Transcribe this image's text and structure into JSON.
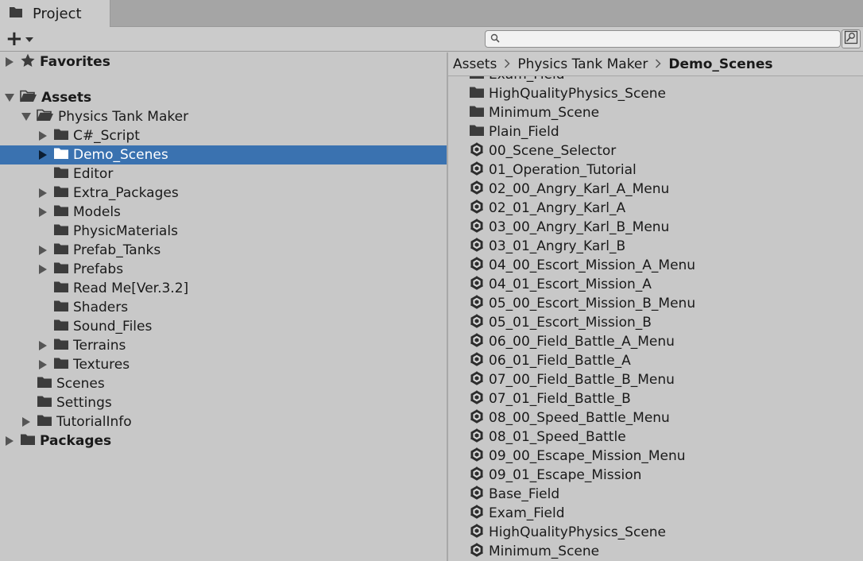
{
  "window": {
    "tab_label": "Project",
    "tab_icon": "folder-icon"
  },
  "toolbar": {
    "create_icon": "plus-icon",
    "search_value": "",
    "search_icon": "search-icon",
    "search_toggle_icon": "search-scope-icon"
  },
  "colors": {
    "selection": "#3a72b0",
    "panel": "#c8c8c8",
    "folder": "#3c3c3c"
  },
  "tree": [
    {
      "label": "Favorites",
      "depth": 0,
      "arrow": "right",
      "icon": "star-icon",
      "bold": true,
      "name": "tree-item-favorites"
    },
    {
      "label": "Assets",
      "depth": 0,
      "arrow": "down",
      "icon": "folder-open-icon",
      "bold": true,
      "name": "tree-item-assets"
    },
    {
      "label": "Physics Tank Maker",
      "depth": 1,
      "arrow": "down",
      "icon": "folder-open-icon",
      "bold": false,
      "name": "tree-item-physics-tank-maker"
    },
    {
      "label": "C#_Script",
      "depth": 2,
      "arrow": "right",
      "icon": "folder-icon",
      "bold": false,
      "name": "tree-item-csharp-script"
    },
    {
      "label": "Demo_Scenes",
      "depth": 2,
      "arrow": "right",
      "icon": "folder-icon",
      "bold": false,
      "selected": true,
      "name": "tree-item-demo-scenes"
    },
    {
      "label": "Editor",
      "depth": 2,
      "arrow": "none",
      "icon": "folder-icon",
      "bold": false,
      "name": "tree-item-editor"
    },
    {
      "label": "Extra_Packages",
      "depth": 2,
      "arrow": "right",
      "icon": "folder-icon",
      "bold": false,
      "name": "tree-item-extra-packages"
    },
    {
      "label": "Models",
      "depth": 2,
      "arrow": "right",
      "icon": "folder-icon",
      "bold": false,
      "name": "tree-item-models"
    },
    {
      "label": "PhysicMaterials",
      "depth": 2,
      "arrow": "none",
      "icon": "folder-icon",
      "bold": false,
      "name": "tree-item-physicmaterials"
    },
    {
      "label": "Prefab_Tanks",
      "depth": 2,
      "arrow": "right",
      "icon": "folder-icon",
      "bold": false,
      "name": "tree-item-prefab-tanks"
    },
    {
      "label": "Prefabs",
      "depth": 2,
      "arrow": "right",
      "icon": "folder-icon",
      "bold": false,
      "name": "tree-item-prefabs"
    },
    {
      "label": "Read Me[Ver.3.2]",
      "depth": 2,
      "arrow": "none",
      "icon": "folder-icon",
      "bold": false,
      "name": "tree-item-read-me"
    },
    {
      "label": "Shaders",
      "depth": 2,
      "arrow": "none",
      "icon": "folder-icon",
      "bold": false,
      "name": "tree-item-shaders"
    },
    {
      "label": "Sound_Files",
      "depth": 2,
      "arrow": "none",
      "icon": "folder-icon",
      "bold": false,
      "name": "tree-item-sound-files"
    },
    {
      "label": "Terrains",
      "depth": 2,
      "arrow": "right",
      "icon": "folder-icon",
      "bold": false,
      "name": "tree-item-terrains"
    },
    {
      "label": "Textures",
      "depth": 2,
      "arrow": "right",
      "icon": "folder-icon",
      "bold": false,
      "name": "tree-item-textures"
    },
    {
      "label": "Scenes",
      "depth": 1,
      "arrow": "none",
      "icon": "folder-icon",
      "bold": false,
      "name": "tree-item-scenes"
    },
    {
      "label": "Settings",
      "depth": 1,
      "arrow": "none",
      "icon": "folder-icon",
      "bold": false,
      "name": "tree-item-settings"
    },
    {
      "label": "TutorialInfo",
      "depth": 1,
      "arrow": "right",
      "icon": "folder-icon",
      "bold": false,
      "name": "tree-item-tutorialinfo"
    },
    {
      "label": "Packages",
      "depth": 0,
      "arrow": "right",
      "icon": "folder-icon",
      "bold": true,
      "name": "tree-item-packages"
    }
  ],
  "breadcrumb": [
    "Assets",
    "Physics Tank Maker",
    "Demo_Scenes"
  ],
  "files": [
    {
      "label": "Exam_Field",
      "icon": "folder-icon"
    },
    {
      "label": "HighQualityPhysics_Scene",
      "icon": "folder-icon"
    },
    {
      "label": "Minimum_Scene",
      "icon": "folder-icon"
    },
    {
      "label": "Plain_Field",
      "icon": "folder-icon"
    },
    {
      "label": "00_Scene_Selector",
      "icon": "unity-scene-icon"
    },
    {
      "label": "01_Operation_Tutorial",
      "icon": "unity-scene-icon"
    },
    {
      "label": "02_00_Angry_Karl_A_Menu",
      "icon": "unity-scene-icon"
    },
    {
      "label": "02_01_Angry_Karl_A",
      "icon": "unity-scene-icon"
    },
    {
      "label": "03_00_Angry_Karl_B_Menu",
      "icon": "unity-scene-icon"
    },
    {
      "label": "03_01_Angry_Karl_B",
      "icon": "unity-scene-icon"
    },
    {
      "label": "04_00_Escort_Mission_A_Menu",
      "icon": "unity-scene-icon"
    },
    {
      "label": "04_01_Escort_Mission_A",
      "icon": "unity-scene-icon"
    },
    {
      "label": "05_00_Escort_Mission_B_Menu",
      "icon": "unity-scene-icon"
    },
    {
      "label": "05_01_Escort_Mission_B",
      "icon": "unity-scene-icon"
    },
    {
      "label": "06_00_Field_Battle_A_Menu",
      "icon": "unity-scene-icon"
    },
    {
      "label": "06_01_Field_Battle_A",
      "icon": "unity-scene-icon"
    },
    {
      "label": "07_00_Field_Battle_B_Menu",
      "icon": "unity-scene-icon"
    },
    {
      "label": "07_01_Field_Battle_B",
      "icon": "unity-scene-icon"
    },
    {
      "label": "08_00_Speed_Battle_Menu",
      "icon": "unity-scene-icon"
    },
    {
      "label": "08_01_Speed_Battle",
      "icon": "unity-scene-icon"
    },
    {
      "label": "09_00_Escape_Mission_Menu",
      "icon": "unity-scene-icon"
    },
    {
      "label": "09_01_Escape_Mission",
      "icon": "unity-scene-icon"
    },
    {
      "label": "Base_Field",
      "icon": "unity-scene-icon"
    },
    {
      "label": "Exam_Field",
      "icon": "unity-scene-icon"
    },
    {
      "label": "HighQualityPhysics_Scene",
      "icon": "unity-scene-icon"
    },
    {
      "label": "Minimum_Scene",
      "icon": "unity-scene-icon"
    }
  ]
}
